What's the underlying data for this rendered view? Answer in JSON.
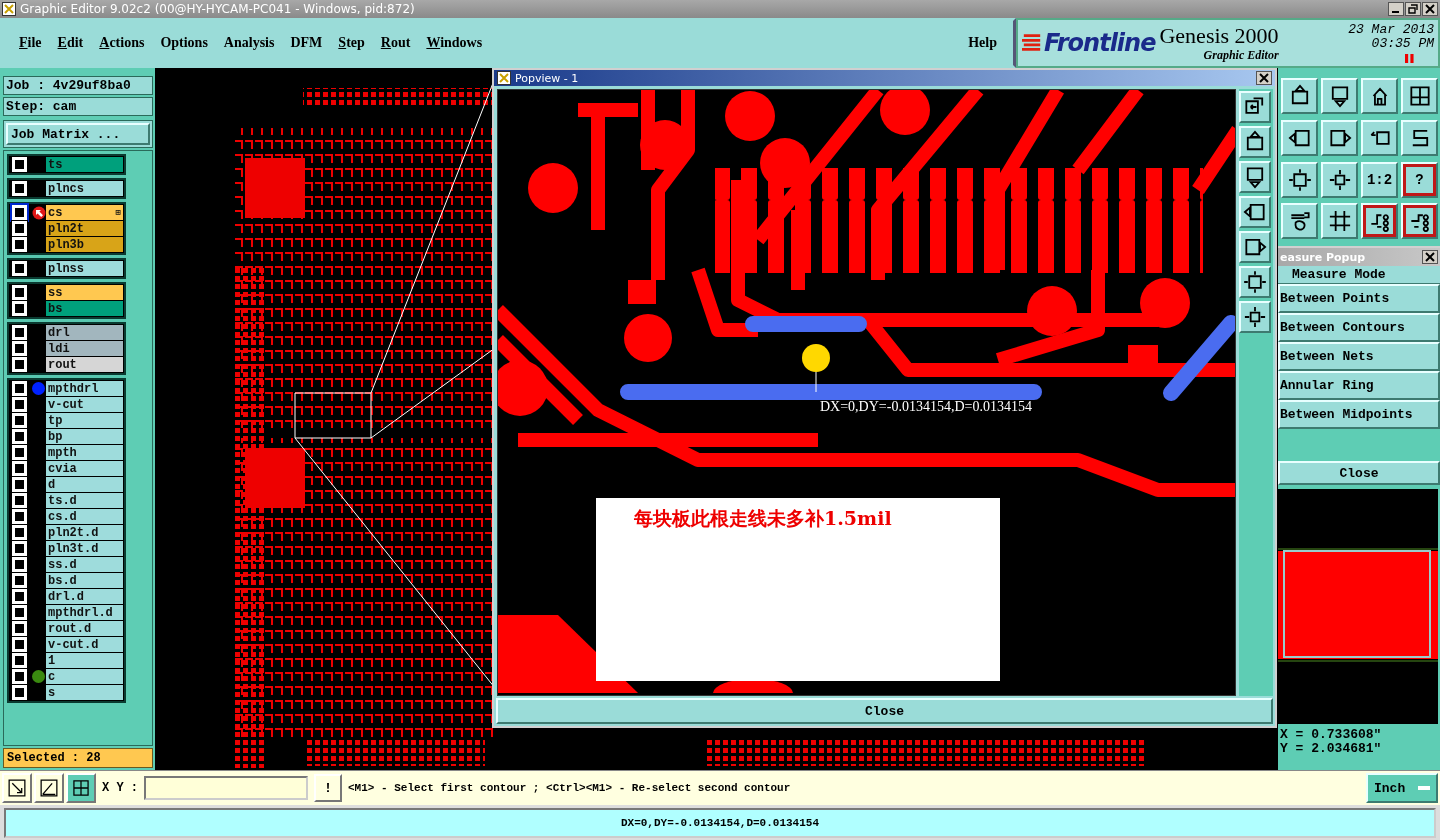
{
  "window": {
    "title": "Graphic Editor 9.02c2 (00@HY-HYCAM-PC041 - Windows, pid:872)"
  },
  "menu": [
    {
      "label": "File",
      "underlined": true
    },
    {
      "label": "Edit",
      "underlined": true
    },
    {
      "label": "Actions",
      "underlined": true
    },
    {
      "label": "Options",
      "underlined": false
    },
    {
      "label": "Analysis",
      "underlined": false
    },
    {
      "label": "DFM",
      "underlined": false
    },
    {
      "label": "Step",
      "underlined": true
    },
    {
      "label": "Rout",
      "underlined": true
    },
    {
      "label": "Windows",
      "underlined": true
    }
  ],
  "help": "Help",
  "brand": {
    "logo": "Frontline",
    "product": "Genesis 2000",
    "subtitle": "Graphic Editor",
    "date": "23 Mar 2013",
    "time": "03:35 PM"
  },
  "job": {
    "job": "Job : 4v29uf8ba0",
    "step": "Step: cam",
    "matrix_button": "Job Matrix ...",
    "selected": "Selected : 28"
  },
  "layer_groups": [
    {
      "layers": [
        {
          "name": "ts",
          "color": "#00a07c",
          "checked": false
        }
      ]
    },
    {
      "layers": [
        {
          "name": "plncs",
          "color": "#9edcdc",
          "checked": false
        }
      ]
    },
    {
      "layers": [
        {
          "name": "cs",
          "color": "#ffc850",
          "checked": false,
          "marker": {
            "kind": "work"
          },
          "badge": "⊞"
        },
        {
          "name": "pln2t",
          "color": "#d8a418",
          "checked": false
        },
        {
          "name": "pln3b",
          "color": "#d8a418",
          "checked": false
        }
      ]
    },
    {
      "layers": [
        {
          "name": "plnss",
          "color": "#9edcdc",
          "checked": false
        }
      ]
    },
    {
      "layers": [
        {
          "name": "ss",
          "color": "#ffc850",
          "checked": false
        },
        {
          "name": "bs",
          "color": "#00a07c",
          "checked": false
        }
      ]
    },
    {
      "layers": [
        {
          "name": "drl",
          "color": "#a2b6be",
          "checked": false
        },
        {
          "name": "ldi",
          "color": "#a2b6be",
          "checked": false
        },
        {
          "name": "rout",
          "color": "#d6d6d6",
          "checked": false
        }
      ]
    },
    {
      "layers": [
        {
          "name": "mpthdrl",
          "color": "#9edcdc",
          "checked": false,
          "marker": {
            "kind": "dot",
            "color": "#0022ff"
          }
        },
        {
          "name": "v-cut",
          "color": "#9edcdc",
          "checked": false
        },
        {
          "name": "tp",
          "color": "#9edcdc",
          "checked": false
        },
        {
          "name": "bp",
          "color": "#9edcdc",
          "checked": false
        },
        {
          "name": "mpth",
          "color": "#9edcdc",
          "checked": false
        },
        {
          "name": "cvia",
          "color": "#9edcdc",
          "checked": false
        },
        {
          "name": "d",
          "color": "#9edcdc",
          "checked": false
        },
        {
          "name": "ts.d",
          "color": "#9edcdc",
          "checked": false
        },
        {
          "name": "cs.d",
          "color": "#9edcdc",
          "checked": false
        },
        {
          "name": "pln2t.d",
          "color": "#9edcdc",
          "checked": false
        },
        {
          "name": "pln3t.d",
          "color": "#9edcdc",
          "checked": false
        },
        {
          "name": "ss.d",
          "color": "#9edcdc",
          "checked": false
        },
        {
          "name": "bs.d",
          "color": "#9edcdc",
          "checked": false
        },
        {
          "name": "drl.d",
          "color": "#9edcdc",
          "checked": false
        },
        {
          "name": "mpthdrl.d",
          "color": "#9edcdc",
          "checked": false
        },
        {
          "name": "rout.d",
          "color": "#9edcdc",
          "checked": false
        },
        {
          "name": "v-cut.d",
          "color": "#9edcdc",
          "checked": false
        },
        {
          "name": "1",
          "color": "#9edcdc",
          "checked": false
        },
        {
          "name": "c",
          "color": "#9edcdc",
          "checked": false,
          "marker": {
            "kind": "dot",
            "color": "#3a8a10"
          }
        },
        {
          "name": "s",
          "color": "#9edcdc",
          "checked": false
        }
      ]
    }
  ],
  "toolbar": [
    {
      "selected": false
    },
    {
      "selected": false
    },
    {
      "selected": false
    },
    {
      "selected": false
    },
    {
      "selected": false
    },
    {
      "selected": false
    },
    {
      "selected": false
    },
    {
      "selected": false
    },
    {
      "selected": false
    },
    {
      "selected": false
    },
    {
      "selected": false,
      "label": "1:2"
    },
    {
      "selected": true,
      "label": "?"
    },
    {
      "selected": false
    },
    {
      "selected": false
    },
    {
      "selected": true
    },
    {
      "selected": true
    }
  ],
  "popview": {
    "title": "Popview - 1",
    "measure_label": "DX=0,DY=-0.0134154,D=0.0134154",
    "note": "每块板此根走线未多补1.5mil",
    "close": "Close"
  },
  "measure_popup": {
    "title": "easure Popup",
    "mode_title": "Measure Mode",
    "modes": [
      "Between Points",
      "Between Contours",
      "Between Nets",
      "Annular Ring",
      "Between Midpoints"
    ],
    "close": "Close",
    "x": "X = 0.733608\"",
    "y": "Y = 2.034681\""
  },
  "bottom": {
    "tools": [
      {
        "selected": false
      },
      {
        "selected": false
      },
      {
        "selected": true
      }
    ],
    "xy_label": "X Y :",
    "bang": "!",
    "prompt": "<M1> - Select first contour ; <Ctrl><M1> - Re-select second contour",
    "units": "Inch"
  },
  "status_bar": "DX=0,DY=-0.0134154,D=0.0134154"
}
